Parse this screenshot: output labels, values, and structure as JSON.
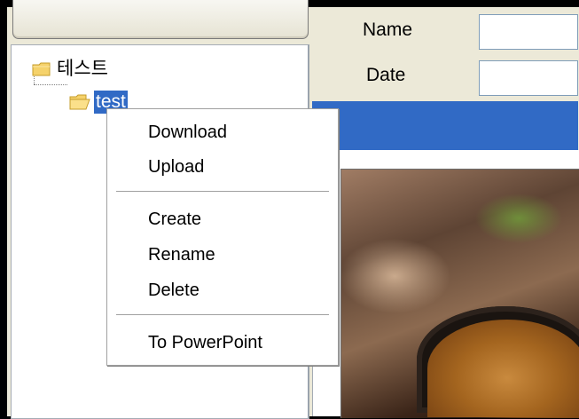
{
  "tree": {
    "root_label": "테스트",
    "child_label": "test"
  },
  "fields": {
    "name_label": "Name",
    "date_label": "Date",
    "name_value": "",
    "date_value": ""
  },
  "context_menu": {
    "download": "Download",
    "upload": "Upload",
    "create": "Create",
    "rename": "Rename",
    "delete": "Delete",
    "to_powerpoint": "To PowerPoint"
  },
  "colors": {
    "selection": "#316ac5",
    "panel_bg": "#ece9d8",
    "folder": "#f5d26b"
  },
  "icons": {
    "root_folder": "folder-closed-icon",
    "child_folder": "folder-open-icon"
  }
}
